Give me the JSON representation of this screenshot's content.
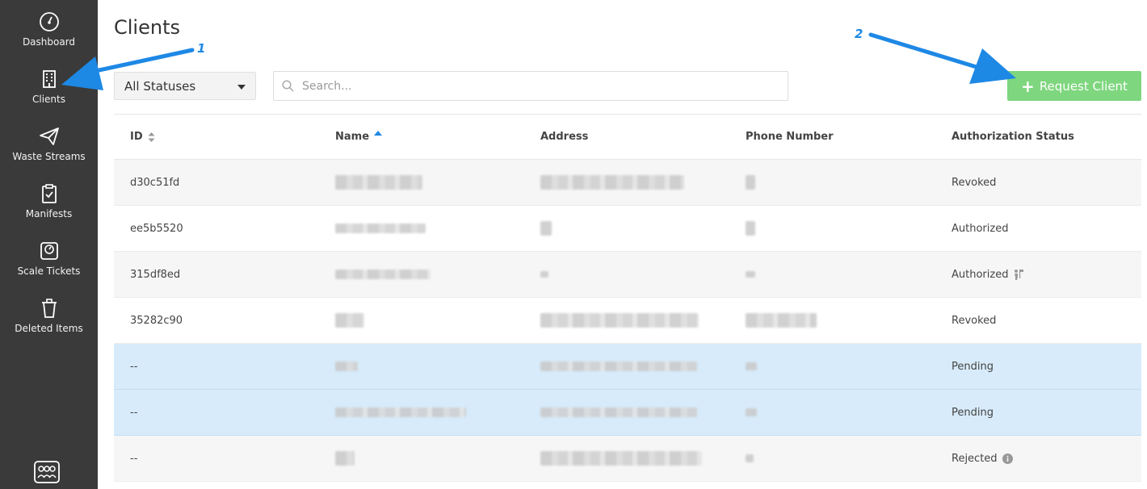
{
  "sidebar": {
    "items": [
      {
        "label": "Dashboard",
        "icon": "gauge-icon"
      },
      {
        "label": "Clients",
        "icon": "building-icon"
      },
      {
        "label": "Waste Streams",
        "icon": "paper-plane-icon"
      },
      {
        "label": "Manifests",
        "icon": "clipboard-check-icon"
      },
      {
        "label": "Scale Tickets",
        "icon": "scale-icon"
      },
      {
        "label": "Deleted Items",
        "icon": "trash-icon"
      }
    ],
    "bottom_icon": "users-group-icon"
  },
  "page": {
    "title": "Clients"
  },
  "filters": {
    "status_select": "All Statuses",
    "search_placeholder": "Search..."
  },
  "actions": {
    "request_client_label": "Request Client",
    "accent_color": "#7ed67e"
  },
  "table": {
    "columns": [
      "ID",
      "Name",
      "Address",
      "Phone Number",
      "Authorization Status"
    ],
    "rows": [
      {
        "id": "d30c51fd",
        "status": "Revoked"
      },
      {
        "id": "ee5b5520",
        "status": "Authorized"
      },
      {
        "id": "315df8ed",
        "status": "Authorized"
      },
      {
        "id": "35282c90",
        "status": "Revoked"
      },
      {
        "id": "--",
        "status": "Pending"
      },
      {
        "id": "--",
        "status": "Pending"
      },
      {
        "id": "--",
        "status": "Rejected"
      }
    ]
  },
  "annotations": [
    "1",
    "2"
  ],
  "colors": {
    "sidebar": "#3a3a3a",
    "selected_row": "#d7ebfa",
    "annotation_arrow": "#1e88e5"
  }
}
